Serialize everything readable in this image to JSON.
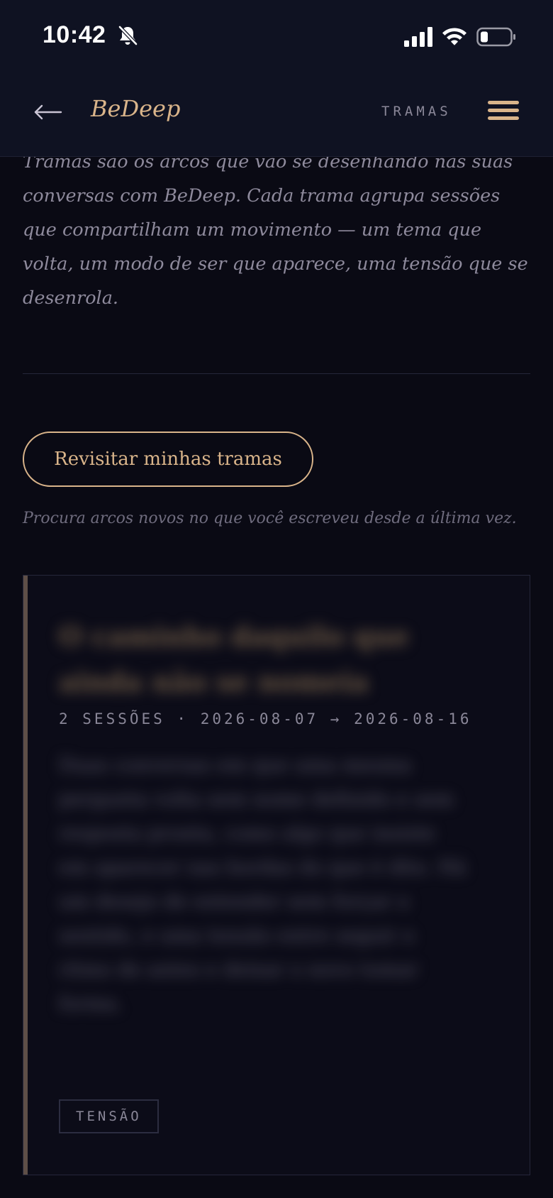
{
  "status_bar": {
    "time": "10:42",
    "icons": [
      "bell-slash-icon",
      "cellular-signal-icon",
      "wifi-icon",
      "battery-icon"
    ]
  },
  "header": {
    "back_icon": "arrow-left-icon",
    "brand": "BeDeep",
    "section": "TRAMAS",
    "menu_icon": "hamburger-menu-icon"
  },
  "intro": {
    "text": "Tramas são os arcos que vão se desenhando nas suas conversas com BeDeep. Cada trama agrupa sessões que compartilham um movimento — um tema que volta, um modo de ser que aparece, uma tensão que se desenrola."
  },
  "revisit": {
    "button_label": "Revisitar minhas tramas",
    "hint": "Procura arcos novos no que você escreveu desde a última vez."
  },
  "card": {
    "title": "O caminho daquilo que ainda não se nomeia",
    "meta": "2 SESSÕES · 2026-08-07 → 2026-08-16",
    "summary": "Duas conversas em que uma mesma pergunta volta sem nome definido e sem resposta pronta, como algo que insiste em aparecer nas bordas do que é dito. Há um desejo de entender sem forçar o sentido, e uma tensão entre seguir o ritmo de antes e deixar o novo tomar forma.",
    "tag": "TENSÃO"
  },
  "colors": {
    "accent": "#d9b48a",
    "background": "#0a0a14",
    "header_bg": "#0f1222",
    "muted_text": "#8e8a9c"
  }
}
